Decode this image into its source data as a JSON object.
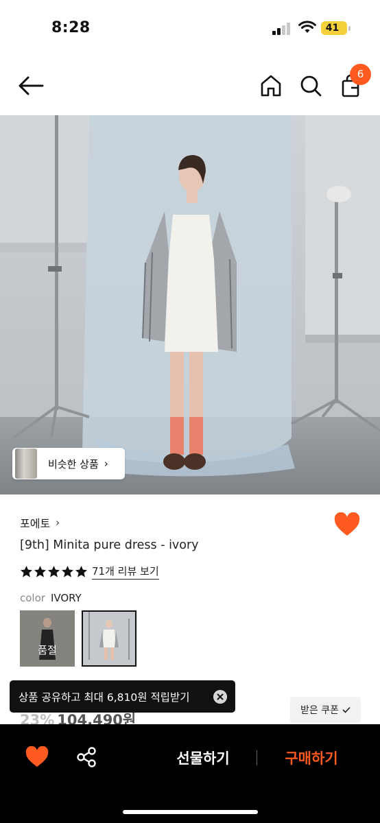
{
  "status_bar": {
    "time": "8:28",
    "battery": "41"
  },
  "nav": {
    "cart_count": "6",
    "icons": [
      "back-arrow-icon",
      "home-icon",
      "search-icon",
      "shopping-bag-icon"
    ]
  },
  "hero": {
    "similar_label": "비슷한 상품",
    "similar_chevron": "›"
  },
  "product": {
    "brand": "포에토",
    "brand_chevron": "›",
    "title": "[9th] Minita pure dress - ivory",
    "rating_stars": 5,
    "review_link": "71개 리뷰 보기",
    "color_label": "color",
    "color_value": "IVORY",
    "swatches": [
      {
        "overlay": "품절"
      },
      {
        "overlay": ""
      }
    ],
    "discount": "23%",
    "price": "104,490원"
  },
  "coupon": {
    "label": "받은 쿠폰"
  },
  "toast": {
    "message": "상품 공유하고 최대 6,810원 적립받기"
  },
  "bottom_bar": {
    "gift_label": "선물하기",
    "buy_label": "구매하기"
  },
  "colors": {
    "accent": "#ff5a1f",
    "heart": "#ff5a1f",
    "battery": "#f4d03a"
  }
}
